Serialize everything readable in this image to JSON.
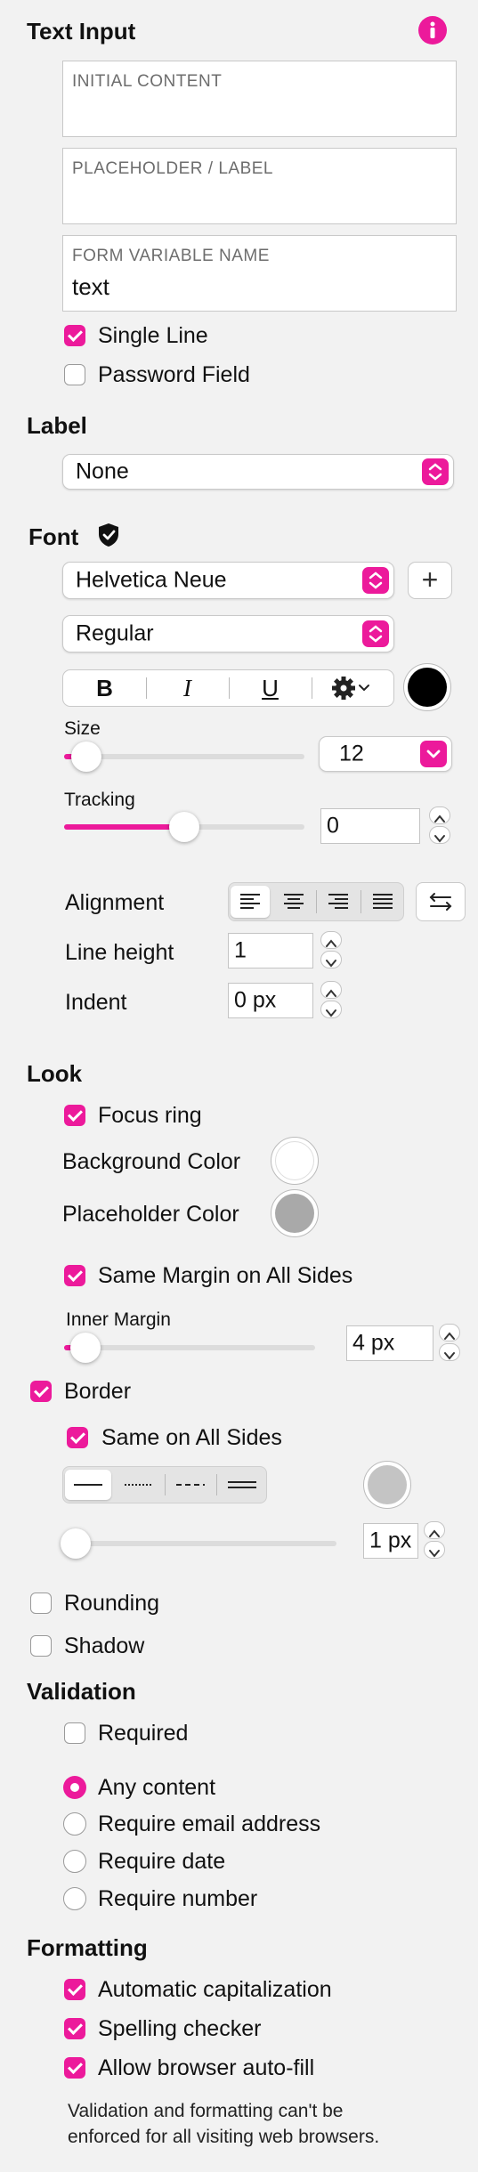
{
  "text_input": {
    "title": "Text Input",
    "info_icon": "info-icon",
    "initial_content": {
      "placeholder": "INITIAL CONTENT",
      "value": ""
    },
    "placeholder_label": {
      "placeholder": "PLACEHOLDER / LABEL",
      "value": ""
    },
    "form_variable": {
      "placeholder": "FORM VARIABLE NAME",
      "value": "text"
    },
    "single_line": {
      "label": "Single Line",
      "checked": true
    },
    "password_field": {
      "label": "Password Field",
      "checked": false
    }
  },
  "label": {
    "title": "Label",
    "selected": "None"
  },
  "font": {
    "title": "Font",
    "badge_icon": "shield-check-icon",
    "family": "Helvetica Neue",
    "add_label": "+",
    "weight": "Regular",
    "bold_label": "B",
    "italic_label": "I",
    "underline_label": "U",
    "text_color": "#000000",
    "size": {
      "label": "Size",
      "value": "12",
      "slider_fraction": 0.03
    },
    "tracking": {
      "label": "Tracking",
      "value": "0",
      "slider_fraction": 0.5
    },
    "alignment_label": "Alignment",
    "line_height": {
      "label": "Line height",
      "value": "1"
    },
    "indent": {
      "label": "Indent",
      "value": "0 px"
    }
  },
  "look": {
    "title": "Look",
    "focus_ring": {
      "label": "Focus ring",
      "checked": true
    },
    "background_color": {
      "label": "Background Color",
      "color": "#ffffff"
    },
    "placeholder_color": {
      "label": "Placeholder Color",
      "color": "#a9a9a9"
    },
    "same_margin": {
      "label": "Same Margin on All Sides",
      "checked": true
    },
    "inner_margin": {
      "label": "Inner Margin",
      "value": "4 px",
      "slider_fraction": 0.03
    },
    "border": {
      "label": "Border",
      "checked": true
    },
    "same_on_all_sides": {
      "label": "Same on All Sides",
      "checked": true
    },
    "border_color": "#c4c4c4",
    "border_width": {
      "value": "1 px",
      "slider_fraction": 0.0
    },
    "rounding": {
      "label": "Rounding",
      "checked": false
    },
    "shadow": {
      "label": "Shadow",
      "checked": false
    }
  },
  "validation": {
    "title": "Validation",
    "required": {
      "label": "Required",
      "checked": false
    },
    "options": [
      {
        "label": "Any content",
        "selected": true
      },
      {
        "label": "Require email address",
        "selected": false
      },
      {
        "label": "Require date",
        "selected": false
      },
      {
        "label": "Require number",
        "selected": false
      }
    ]
  },
  "formatting": {
    "title": "Formatting",
    "auto_cap": {
      "label": "Automatic capitalization",
      "checked": true
    },
    "spelling": {
      "label": "Spelling checker",
      "checked": true
    },
    "autofill": {
      "label": "Allow browser auto-fill",
      "checked": true
    },
    "note_line1": "Validation and formatting can't be",
    "note_line2": "enforced for all visiting web browsers."
  },
  "colors": {
    "accent": "#ec1a9b"
  }
}
